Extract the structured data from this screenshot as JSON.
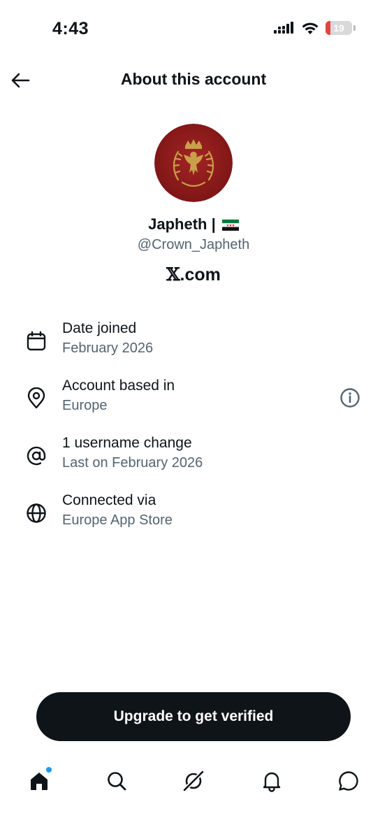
{
  "status_bar": {
    "time": "4:43",
    "battery_level": "19",
    "battery_fraction": 0.19,
    "battery_color": "#e0463e"
  },
  "header": {
    "title": "About this account",
    "back_icon": "arrow-left-icon"
  },
  "profile": {
    "display_name": "Japheth |",
    "flag_icon": "syria-flag-icon",
    "handle": "@Crown_Japheth",
    "site_glyph": "𝕏",
    "site_suffix": ".com"
  },
  "details": [
    {
      "icon": "calendar-icon",
      "title": "Date joined",
      "value": "February 2026"
    },
    {
      "icon": "location-pin-icon",
      "title": "Account based in",
      "value": "Europe",
      "has_info": true
    },
    {
      "icon": "at-sign-icon",
      "title": "1 username change",
      "value": "Last on February 2026"
    },
    {
      "icon": "globe-icon",
      "title": "Connected via",
      "value": "Europe App Store"
    }
  ],
  "cta": {
    "label": "Upgrade to get verified"
  },
  "nav": [
    {
      "icon": "home-icon",
      "active": true,
      "badge": true
    },
    {
      "icon": "search-icon"
    },
    {
      "icon": "grok-icon"
    },
    {
      "icon": "bell-icon"
    },
    {
      "icon": "chat-icon"
    }
  ],
  "colors": {
    "text_primary": "#0f1419",
    "text_secondary": "#536471",
    "button_bg": "#0f1419",
    "badge_blue": "#1d9bf0",
    "avatar_red": "#8b1a1a",
    "crest_gold": "#c9a04a"
  }
}
